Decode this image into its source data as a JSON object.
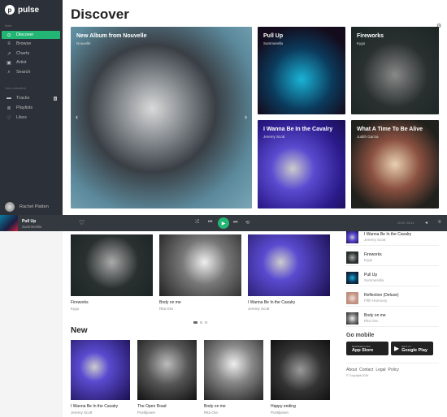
{
  "app": {
    "name": "pulse"
  },
  "sidebar": {
    "main_label": "Main",
    "items": [
      {
        "label": "Discover",
        "icon": "compass-icon"
      },
      {
        "label": "Browse",
        "icon": "list-icon"
      },
      {
        "label": "Charts",
        "icon": "trending-icon"
      },
      {
        "label": "Artist",
        "icon": "artist-icon"
      },
      {
        "label": "Search",
        "icon": "search-icon"
      }
    ],
    "collection_label": "Your collection",
    "collection": [
      {
        "label": "Tracks",
        "badge": "8"
      },
      {
        "label": "Playlists"
      },
      {
        "label": "Likes"
      }
    ],
    "user": "Rachel Platten"
  },
  "page": {
    "title": "Discover"
  },
  "featured": {
    "title": "New Album from Nouvelle",
    "subtitle": "Nouvelle"
  },
  "grid": [
    {
      "title": "Pull Up",
      "subtitle": "Summerella"
    },
    {
      "title": "Fireworks",
      "subtitle": "Kygo"
    },
    {
      "title": "I Wanna Be In the Cavalry",
      "subtitle": "Jeremy Scott"
    },
    {
      "title": "What A Time To Be Alive",
      "subtitle": "Judith Garcia"
    }
  ],
  "player": {
    "title": "Pull Up",
    "artist": "Summerella",
    "time": "00:00 / 04:14"
  },
  "carousel": [
    {
      "title": "Fireworks",
      "artist": "Kygo"
    },
    {
      "title": "Body on me",
      "artist": "Rita Ora"
    },
    {
      "title": "I Wanna Be In the Cavalry",
      "artist": "Jeremy Scott"
    }
  ],
  "new": {
    "heading": "New",
    "items": [
      {
        "title": "I Wanna Be In the Cavalry",
        "artist": "Jeremy Scott"
      },
      {
        "title": "The Open Road",
        "artist": "Postiljonen"
      },
      {
        "title": "Body on me",
        "artist": "Rita Ora"
      },
      {
        "title": "Happy ending",
        "artist": "Postiljonen"
      }
    ]
  },
  "side_list": [
    {
      "title": "I Wanna Be In the Cavalry",
      "artist": "Jeremy Scott"
    },
    {
      "title": "Fireworks",
      "artist": "Kygo"
    },
    {
      "title": "Pull Up",
      "artist": "Summerella"
    },
    {
      "title": "Reflection (Deluxe)",
      "artist": "Fifth Harmony"
    },
    {
      "title": "Body on me",
      "artist": "Rita Ora"
    }
  ],
  "mobile": {
    "heading": "Go mobile",
    "appstore_small": "Download on the",
    "appstore": "App Store",
    "play_small": "Get it on",
    "play": "Google Play"
  },
  "footer": {
    "links": [
      "About",
      "Contact",
      "Legal",
      "Policy"
    ],
    "copyright": "© Copyright 2016"
  },
  "colors": {
    "accent": "#22b573",
    "sidebar": "#2c3038",
    "player": "#34383f"
  }
}
